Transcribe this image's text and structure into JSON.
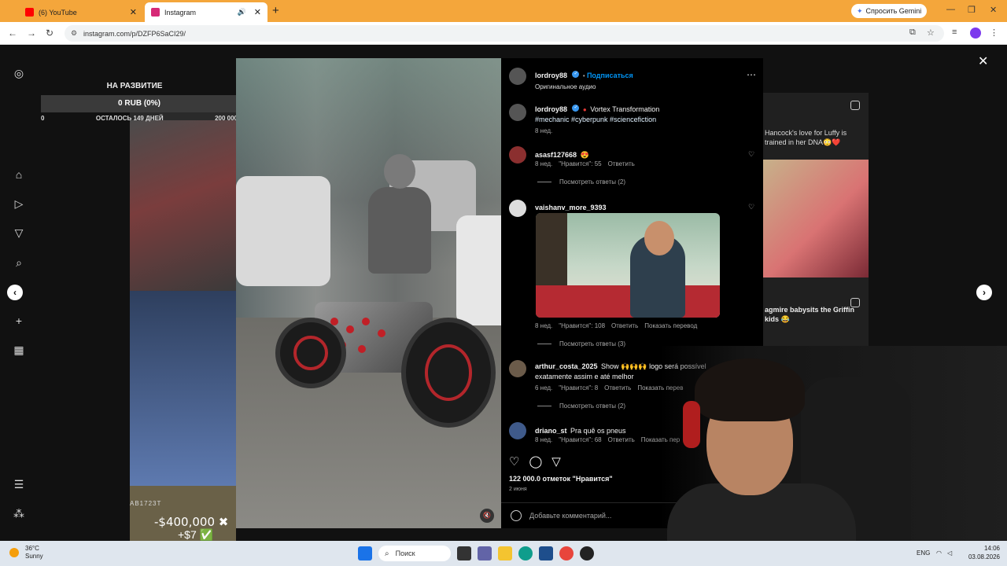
{
  "browser": {
    "tabs": [
      {
        "title": "(6) YouTube",
        "active": false,
        "favicon_color": "#ff0000"
      },
      {
        "title": "Instagram",
        "active": true,
        "favicon_color": "#d62976"
      }
    ],
    "gemini_label": "Спросить Gemini",
    "url": "instagram.com/p/DZFP6SaCI29/"
  },
  "fundraise": {
    "title": "НА РАЗВИТИЕ",
    "progress_label": "0 RUB (0%)",
    "progress_fraction": 0,
    "min": "0",
    "days_left": "ОСТАЛОСЬ 149 ДНЕЙ",
    "max": "200 000"
  },
  "background_captions": {
    "right_top": "Hancock's love for Luffy is trained in her DNA😳❤️",
    "right_bottom": "agmire babysits the Griffin kids 😂",
    "left_money": "-$400,000 ✖",
    "left_money2": "+$7 ✅"
  },
  "post": {
    "author": "lordroy88",
    "follow_label": "Подписаться",
    "audio": "Оригинальное аудио",
    "caption_title": "Vortex Transformation",
    "caption_tags": "#mechanic #cyberpunk #sciencefiction",
    "caption_age": "8 нед.",
    "plate_text": "AB1723T",
    "likes": "122 000.0 отметок \"Нравится\"",
    "date": "2 июня",
    "comment_placeholder": "Добавьте комментарий..."
  },
  "comments": [
    {
      "user": "asasf127668",
      "text": "😍",
      "age": "8 нед.",
      "likes": "\"Нравится\": 55",
      "reply": "Ответить",
      "translate": "",
      "view_replies": "Посмотреть ответы (2)"
    },
    {
      "user": "vaishanv_more_9393",
      "text": "",
      "age": "8 нед.",
      "likes": "\"Нравится\": 108",
      "reply": "Ответить",
      "translate": "Показать перевод",
      "view_replies": "Посмотреть ответы (3)"
    },
    {
      "user": "arthur_costa_2025",
      "text": "Show 🙌🙌🙌 logo será possível exatamente assim e até melhor",
      "age": "6 нед.",
      "likes": "\"Нравится\": 8",
      "reply": "Ответить",
      "translate": "Показать перев",
      "view_replies": "Посмотреть ответы (2)"
    },
    {
      "user": "driano_st",
      "text": "Pra quê os pneus",
      "age": "8 нед.",
      "likes": "\"Нравится\": 68",
      "reply": "Ответить",
      "translate": "Показать пер",
      "view_replies": ""
    }
  ],
  "taskbar": {
    "weather_temp": "36°C",
    "weather_desc": "Sunny",
    "search_placeholder": "Поиск",
    "lang": "ENG",
    "time": "14:06",
    "date": "03.08.2026"
  },
  "icons": {
    "sidebar": [
      "instagram-icon",
      "home-icon",
      "reels-icon",
      "send-icon",
      "search-icon",
      "explore-icon",
      "create-icon",
      "stats-icon",
      "menu-icon",
      "meta-icon"
    ]
  },
  "colors": {
    "tab_bar": "#f4a63b",
    "link_blue": "#0095f6",
    "panel_bg": "#000000"
  }
}
